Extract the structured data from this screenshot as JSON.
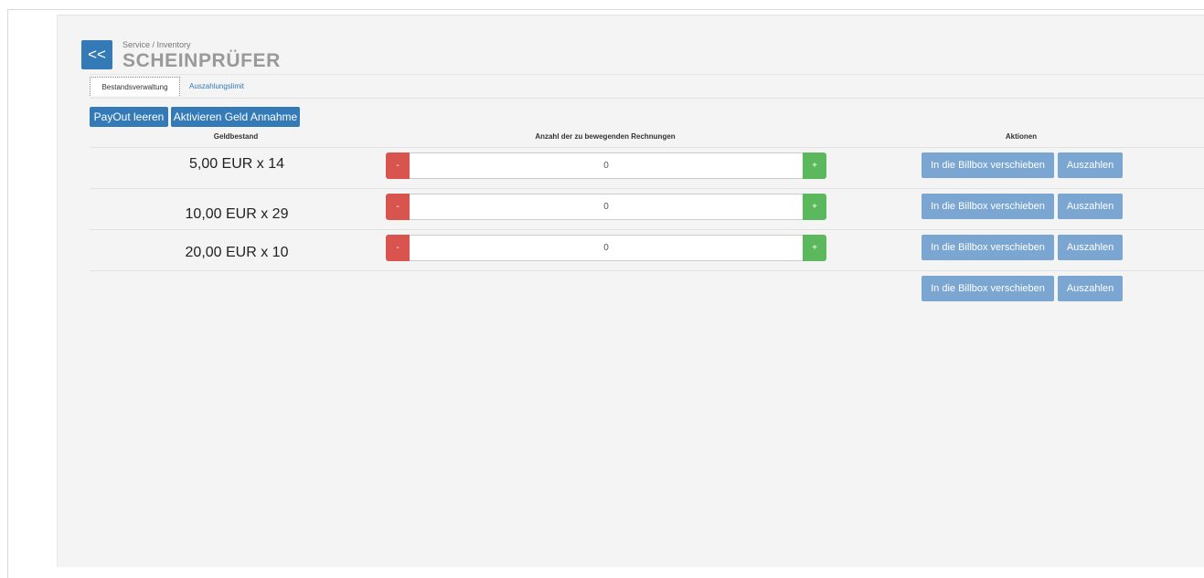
{
  "header": {
    "back_label": "<<",
    "breadcrumb": "Service / Inventory",
    "title": "SCHEINPRÜFER"
  },
  "tabs": [
    {
      "label": "Bestandsverwaltung",
      "active": true
    },
    {
      "label": "Auszahlungslimit",
      "active": false
    }
  ],
  "toolbar": {
    "payout_empty_label": "PayOut leeren",
    "activate_label": "Aktivieren Geld Annahme"
  },
  "table": {
    "headers": [
      "Geldbestand",
      "Anzahl der zu bewegenden Rechnungen",
      "Aktionen"
    ],
    "rows": [
      {
        "bill": "5,00 EUR x 14",
        "quantity": "0"
      },
      {
        "bill": "10,00 EUR x 29",
        "quantity": "0"
      },
      {
        "bill": "20,00 EUR x 10",
        "quantity": "0"
      }
    ],
    "minus_label": "-",
    "plus_label": "+",
    "move_label": "In die Billbox verschieben",
    "pay_label": "Auszahlen"
  },
  "colors": {
    "primary": "#337ab7",
    "danger": "#d9534f",
    "success": "#5cb85c",
    "action_muted": "#7aa6d1"
  }
}
